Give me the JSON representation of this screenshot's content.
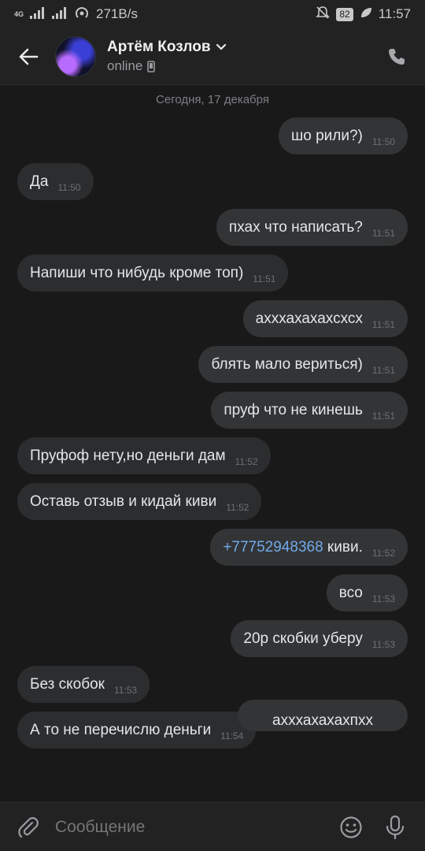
{
  "status_bar": {
    "net_tag": "4G",
    "speed": "271B/s",
    "battery": "82",
    "time": "11:57"
  },
  "header": {
    "contact_name": "Артём Козлов",
    "status": "online"
  },
  "chat": {
    "date_separator": "Сегодня, 17 декабря",
    "messages": [
      {
        "dir": "out",
        "text": "шо рили?)",
        "time": "11:50"
      },
      {
        "dir": "in",
        "text": "Да",
        "time": "11:50"
      },
      {
        "dir": "out",
        "text": "пхах что написать?",
        "time": "11:51"
      },
      {
        "dir": "in",
        "text": "Напиши что нибудь кроме топ)",
        "time": "11:51"
      },
      {
        "dir": "out",
        "text": "ахххахахахсхсх",
        "time": "11:51"
      },
      {
        "dir": "out",
        "text": "блять мало вериться)",
        "time": "11:51"
      },
      {
        "dir": "out",
        "text": "пруф что не кинешь",
        "time": "11:51"
      },
      {
        "dir": "in",
        "text": "Пруфоф нету,но деньги дам",
        "time": "11:52"
      },
      {
        "dir": "in",
        "text": "Оставь отзыв и кидай киви",
        "time": "11:52"
      },
      {
        "dir": "out",
        "link": "+77752948368",
        "text": " киви.",
        "time": "11:52"
      },
      {
        "dir": "out",
        "text": "всо",
        "time": "11:53"
      },
      {
        "dir": "out",
        "text": "20р скобки уберу",
        "time": "11:53"
      },
      {
        "dir": "in",
        "text": "Без скобок",
        "time": "11:53"
      },
      {
        "dir": "in",
        "text": "А то не перечислю деньги",
        "time": "11:54"
      }
    ],
    "partial_message": "ахххахахахпхх"
  },
  "composer": {
    "placeholder": "Сообщение"
  },
  "colors": {
    "background": "#19191a",
    "bar": "#222223",
    "bubble": "#2c2d2e",
    "link": "#71aaeb"
  },
  "icons": {
    "back": "arrow-left-icon",
    "call": "phone-icon",
    "device": "mobile-phone-icon",
    "attach": "paperclip-icon",
    "emoji": "smile-icon",
    "voice": "microphone-icon"
  }
}
